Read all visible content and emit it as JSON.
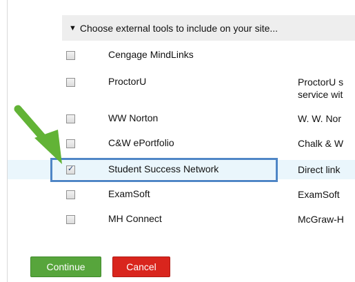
{
  "section": {
    "toggle_glyph": "▼",
    "title": "Choose external tools to include on your site..."
  },
  "tools": [
    {
      "name": "Cengage MindLinks",
      "desc": "",
      "checked": false
    },
    {
      "name": "ProctorU",
      "desc": "ProctorU s",
      "desc2": "service wit",
      "checked": false
    },
    {
      "name": "WW Norton",
      "desc": "W. W. Nor",
      "checked": false
    },
    {
      "name": "C&W ePortfolio",
      "desc": "Chalk & W",
      "checked": false
    },
    {
      "name": "Student Success Network",
      "desc": "Direct link",
      "checked": true
    },
    {
      "name": "ExamSoft",
      "desc": "ExamSoft",
      "checked": false
    },
    {
      "name": "MH Connect",
      "desc": "McGraw-H",
      "checked": false
    }
  ],
  "buttons": {
    "continue_label": "Continue",
    "cancel_label": "Cancel"
  },
  "colors": {
    "continue": "#57a53c",
    "cancel": "#d9251d",
    "highlight": "#4f86c6",
    "arrow": "#62b336"
  },
  "annotation": {
    "arrow_icon": "green-pointer-arrow-icon",
    "highlight_target": "Student Success Network"
  }
}
